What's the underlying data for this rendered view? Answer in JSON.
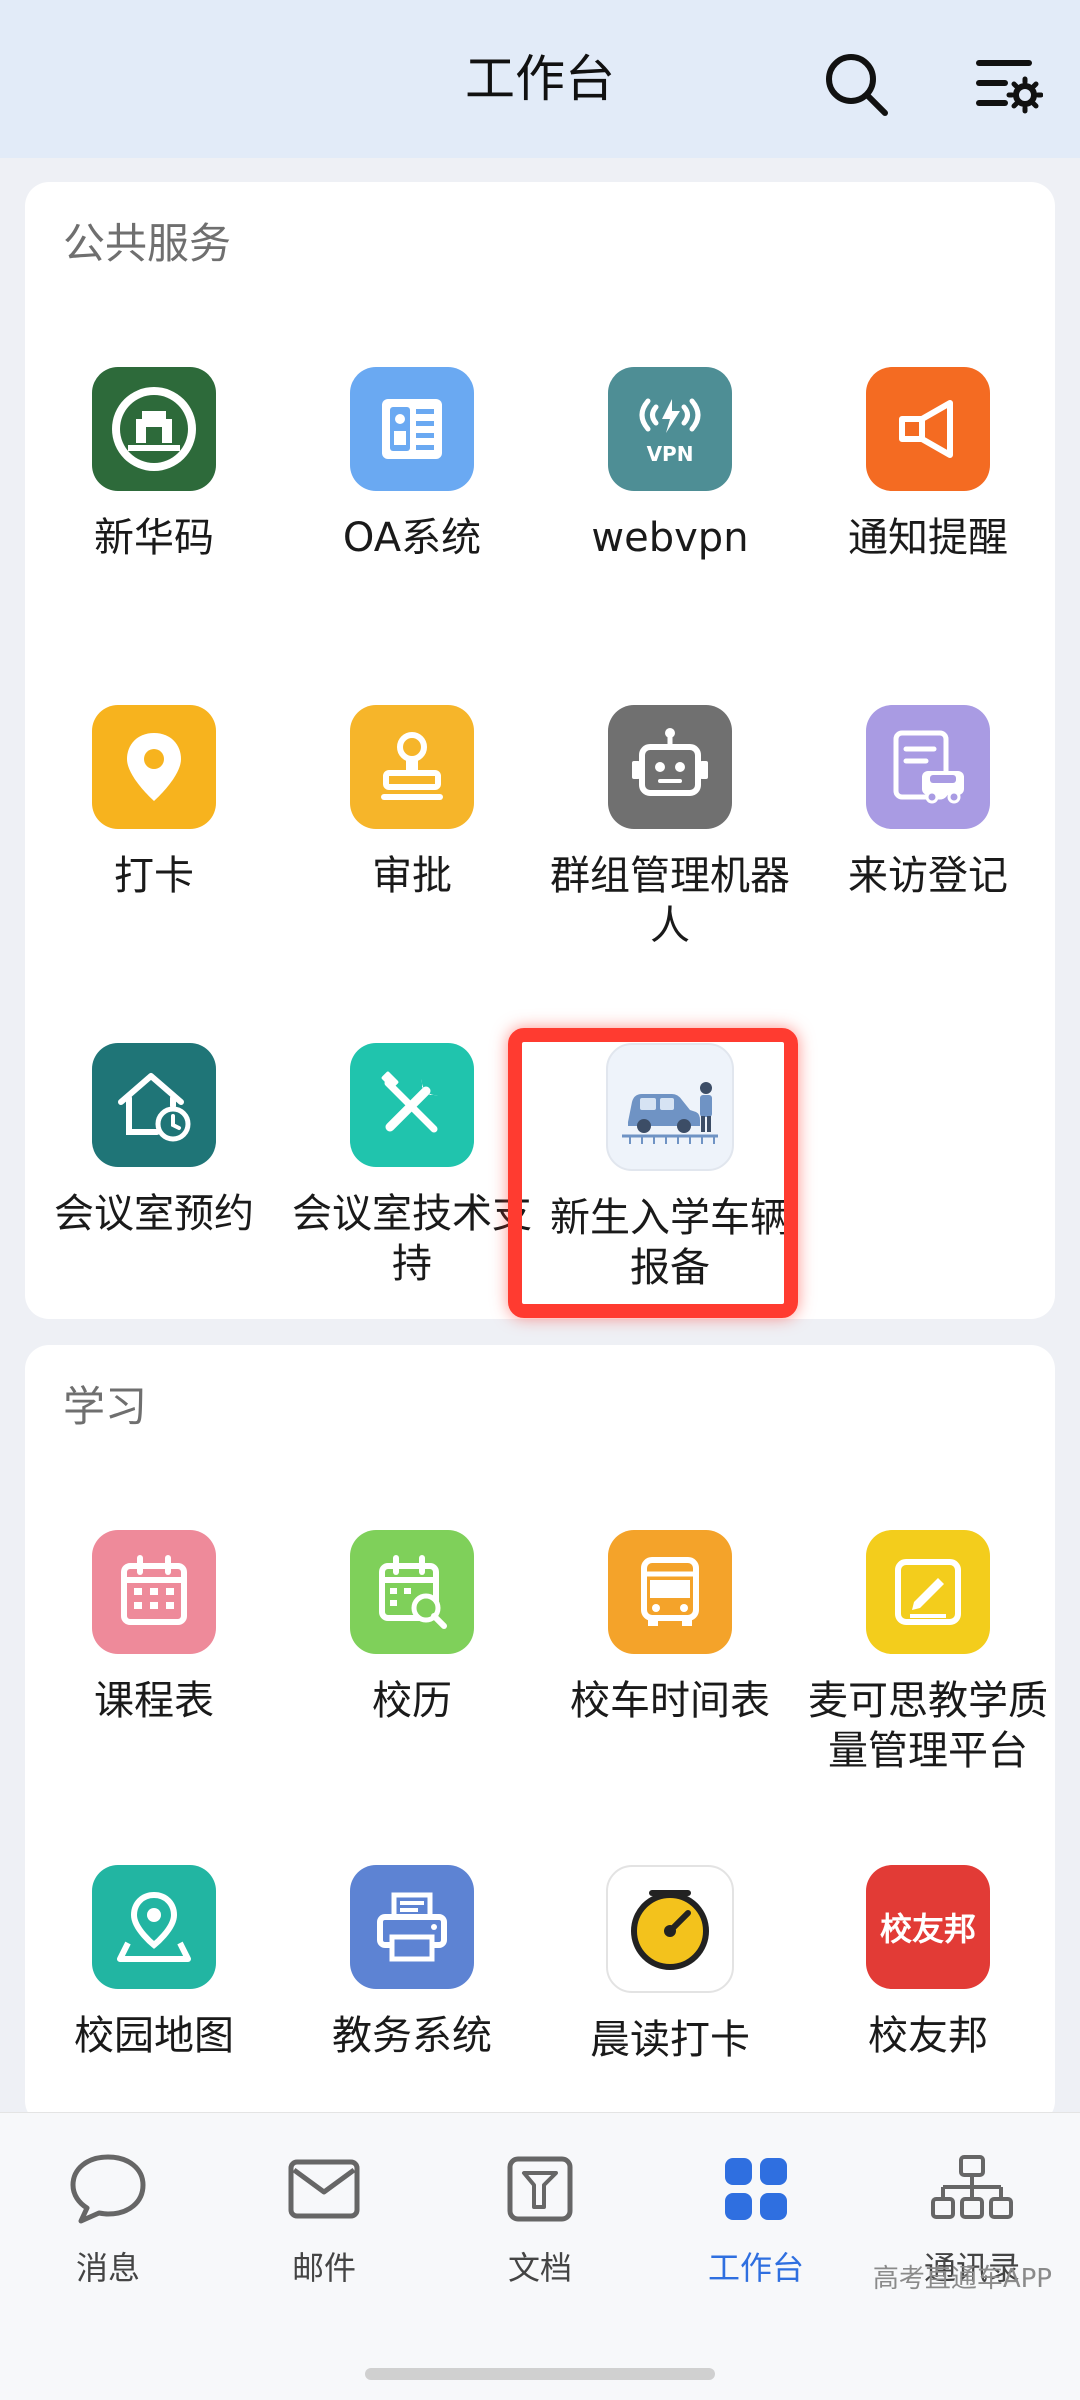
{
  "header": {
    "title": "工作台"
  },
  "sections": {
    "public": {
      "title": "公共服务",
      "items": [
        {
          "label": "新华码",
          "icon": "campus-emblem-icon",
          "color": "#2d6a3a"
        },
        {
          "label": "OA系统",
          "icon": "document-icon",
          "color": "#6aa9f2"
        },
        {
          "label": "webvpn",
          "icon": "vpn-icon",
          "color": "#4e8e95"
        },
        {
          "label": "通知提醒",
          "icon": "megaphone-icon",
          "color": "#f46b22"
        },
        {
          "label": "打卡",
          "icon": "location-pin-icon",
          "color": "#f7b31e"
        },
        {
          "label": "审批",
          "icon": "stamp-icon",
          "color": "#f6b52a"
        },
        {
          "label": "群组管理机器人",
          "icon": "robot-icon",
          "color": "#707070"
        },
        {
          "label": "来访登记",
          "icon": "visitor-car-icon",
          "color": "#a99be3"
        },
        {
          "label": "会议室预约",
          "icon": "home-clock-icon",
          "color": "#1f7577"
        },
        {
          "label": "会议室技术支持",
          "icon": "tools-icon",
          "color": "#20c4ad"
        },
        {
          "label": "新生入学车辆报备",
          "icon": "car-person-icon",
          "color": "#eef3fa"
        }
      ]
    },
    "study": {
      "title": "学习",
      "items": [
        {
          "label": "课程表",
          "icon": "calendar-icon",
          "color": "#ee8a9a"
        },
        {
          "label": "校历",
          "icon": "calendar-search-icon",
          "color": "#7fd05a"
        },
        {
          "label": "校车时间表",
          "icon": "bus-icon",
          "color": "#f4a32a"
        },
        {
          "label": "麦可思教学质量管理平台",
          "icon": "edit-note-icon",
          "color": "#f3cd1c"
        },
        {
          "label": "校园地图",
          "icon": "map-pin-icon",
          "color": "#22b5a2"
        },
        {
          "label": "教务系统",
          "icon": "printer-icon",
          "color": "#5d83d3"
        },
        {
          "label": "晨读打卡",
          "icon": "alarm-clock-icon",
          "color": "#ffffff"
        },
        {
          "label": "校友邦",
          "icon": "alumni-logo-icon",
          "color": "#e23b36",
          "logo_text": "校友邦"
        }
      ]
    }
  },
  "tabbar": {
    "items": [
      {
        "label": "消息",
        "icon": "chat-bubble-icon"
      },
      {
        "label": "邮件",
        "icon": "mail-icon"
      },
      {
        "label": "文档",
        "icon": "document-icon"
      },
      {
        "label": "工作台",
        "icon": "grid-icon",
        "active": true
      },
      {
        "label": "通讯录",
        "icon": "org-chart-icon"
      }
    ]
  },
  "watermark": "高考直通车APP"
}
